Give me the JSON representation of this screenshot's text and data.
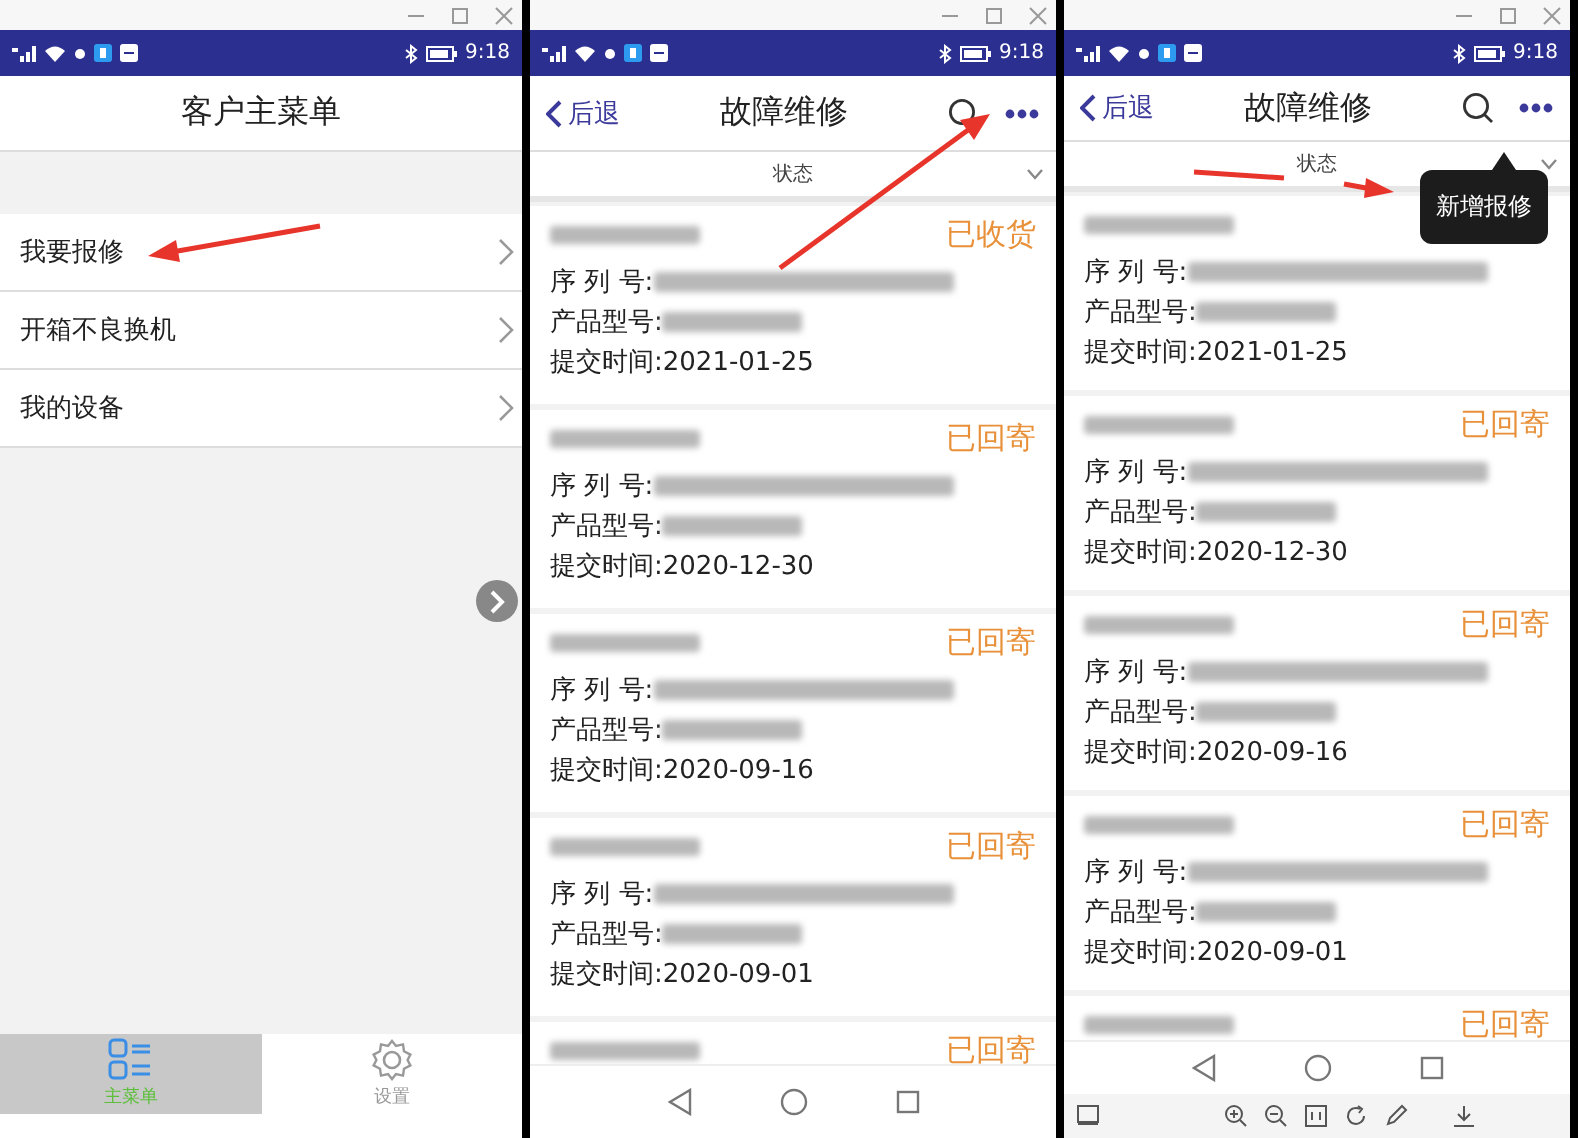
{
  "panels": [
    {
      "kind": "menu",
      "status_bar": {
        "time": "9:18"
      },
      "title": "客户主菜单",
      "menu_items": [
        {
          "label": "我要报修"
        },
        {
          "label": "开箱不良换机"
        },
        {
          "label": "我的设备"
        }
      ],
      "bottom_tabs": [
        {
          "label": "主菜单",
          "selected": true
        },
        {
          "label": "设置",
          "selected": false
        }
      ]
    },
    {
      "kind": "list",
      "status_bar": {
        "time": "9:18"
      },
      "back": "后退",
      "title": "故障维修",
      "filter": "状态",
      "records": [
        {
          "status": "已收货",
          "serial_label": "序 列 号:",
          "model_label": "产品型号:",
          "submitted": "提交时间:2021-01-25",
          "partial": false
        },
        {
          "status": "已回寄",
          "serial_label": "序 列 号:",
          "model_label": "产品型号:",
          "submitted": "提交时间:2020-12-30",
          "partial": false
        },
        {
          "status": "已回寄",
          "serial_label": "序 列 号:",
          "model_label": "产品型号:",
          "submitted": "提交时间:2020-09-16",
          "partial": false
        },
        {
          "status": "已回寄",
          "serial_label": "序 列 号:",
          "model_label": "产品型号:",
          "submitted": "提交时间:2020-09-01",
          "partial": false
        },
        {
          "status": "已回寄",
          "partial": true
        }
      ]
    },
    {
      "kind": "list",
      "status_bar": {
        "time": "9:18"
      },
      "back": "后退",
      "title": "故障维修",
      "filter": "状态",
      "tooltip": "新增报修",
      "viewer_toolbar": true,
      "records": [
        {
          "serial_label": "序 列 号:",
          "model_label": "产品型号:",
          "submitted": "提交时间:2021-01-25",
          "partial": false
        },
        {
          "status": "已回寄",
          "serial_label": "序 列 号:",
          "model_label": "产品型号:",
          "submitted": "提交时间:2020-12-30",
          "partial": false
        },
        {
          "status": "已回寄",
          "serial_label": "序 列 号:",
          "model_label": "产品型号:",
          "submitted": "提交时间:2020-09-16",
          "partial": false
        },
        {
          "status": "已回寄",
          "serial_label": "序 列 号:",
          "model_label": "产品型号:",
          "submitted": "提交时间:2020-09-01",
          "partial": false
        },
        {
          "status": "已回寄",
          "partial": true
        }
      ]
    }
  ]
}
